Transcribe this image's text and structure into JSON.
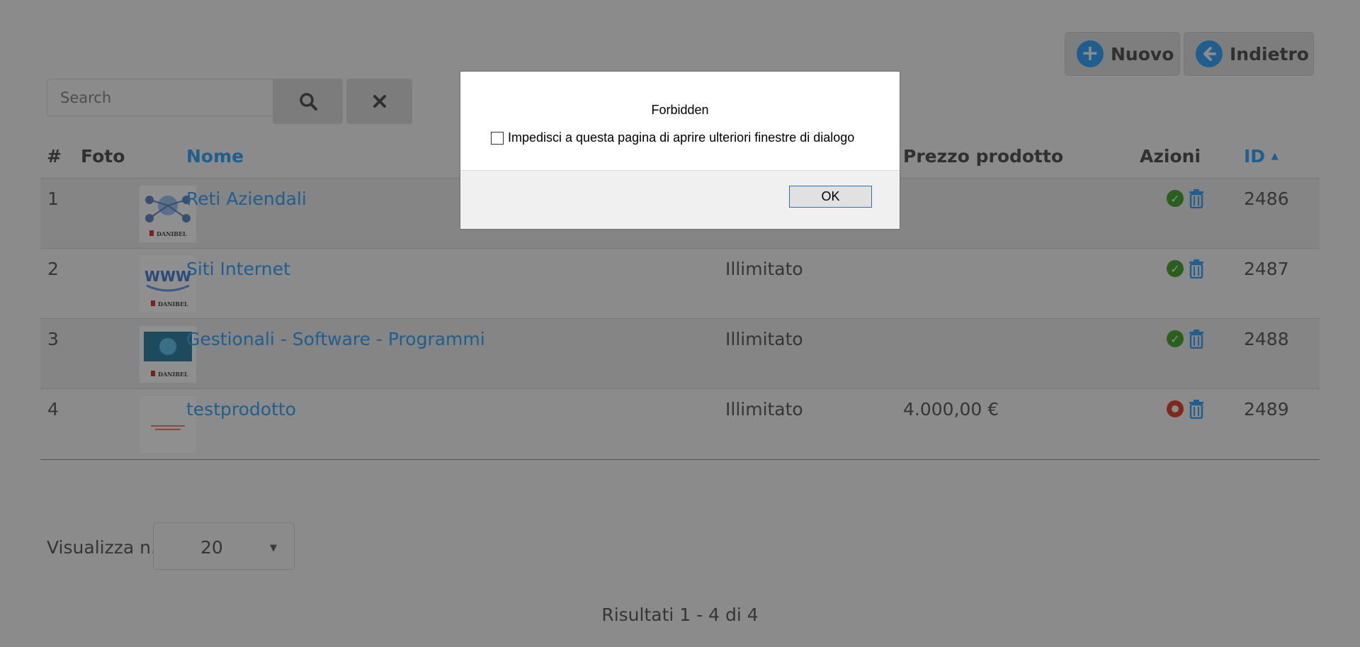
{
  "toolbar": {
    "new_label": "Nuovo",
    "back_label": "Indietro"
  },
  "search": {
    "placeholder": "Search"
  },
  "table": {
    "headers": {
      "index": "#",
      "photo": "Foto",
      "name": "Nome",
      "price": "Prezzo prodotto",
      "actions": "Azioni",
      "id": "ID"
    },
    "rows": [
      {
        "index": "1",
        "name": "Reti Aziendali",
        "availability": "",
        "price": "",
        "status": "active",
        "id": "2486",
        "thumb_brand": "DANIBEL"
      },
      {
        "index": "2",
        "name": "Siti Internet",
        "availability": "Illimitato",
        "price": "",
        "status": "active",
        "id": "2487",
        "thumb_brand": "DANIBEL"
      },
      {
        "index": "3",
        "name": "Gestionali - Software - Programmi",
        "availability": "Illimitato",
        "price": "",
        "status": "active",
        "id": "2488",
        "thumb_brand": "DANIBEL"
      },
      {
        "index": "4",
        "name": "testprodotto",
        "availability": "Illimitato",
        "price": "4.000,00 €",
        "status": "inactive",
        "id": "2489",
        "thumb_brand": ""
      }
    ]
  },
  "pager": {
    "label": "Visualizza n.",
    "page_size": "20",
    "results": "Risultati 1 - 4 di 4"
  },
  "dialog": {
    "title": "Forbidden",
    "checkbox_label": "Impedisci a questa pagina di aprire ulteriori finestre di dialogo",
    "ok_label": "OK"
  },
  "colors": {
    "overlay_bg": "#8b8b8b",
    "link": "#1f5e8e",
    "status_active": "#2a5f1e",
    "status_inactive": "#7e2a1a"
  }
}
